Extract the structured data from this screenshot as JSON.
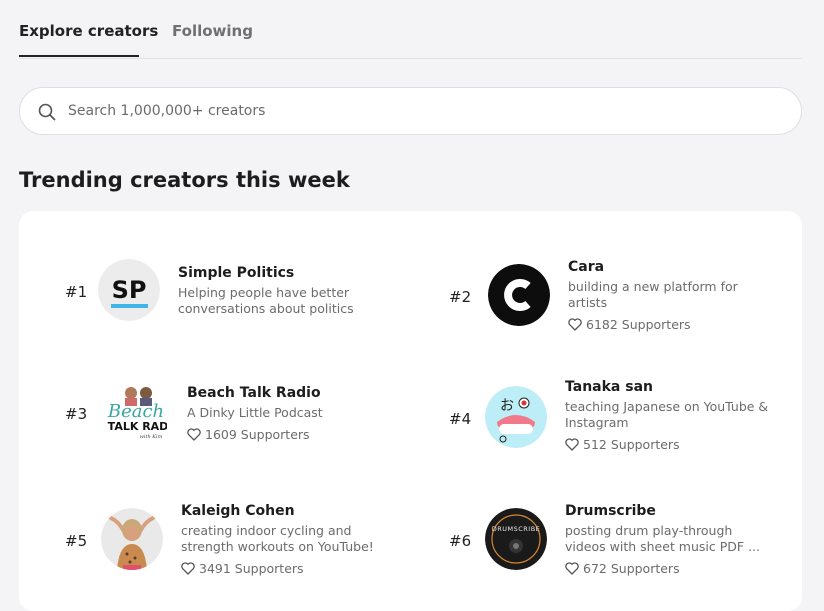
{
  "tabs": [
    {
      "label": "Explore creators"
    },
    {
      "label": "Following"
    }
  ],
  "search": {
    "placeholder": "Search 1,000,000+ creators",
    "value": ""
  },
  "trending": {
    "title": "Trending creators this week"
  },
  "creators": [
    {
      "rank": "#1",
      "name": "Simple Politics",
      "description": "Helping people have better conversations about politics",
      "supporters": "",
      "avatar": {
        "text": "SP",
        "colors": {
          "bg": "#ececec",
          "text": "#111111",
          "underline": "#3fb6e8"
        }
      }
    },
    {
      "rank": "#2",
      "name": "Cara",
      "description": "building a new platform for artists",
      "supporters": "6182 Supporters",
      "avatar": {
        "text": "C",
        "colors": {
          "bg": "#0d0d0d",
          "text": "#ffffff"
        }
      }
    },
    {
      "rank": "#3",
      "name": "Beach Talk Radio",
      "description": "A Dinky Little Podcast",
      "supporters": "1609 Supporters",
      "avatar": {
        "text": "Beach TALK RAD",
        "colors": {
          "bg": "#ffffff",
          "accent": "#3aa7a0"
        }
      }
    },
    {
      "rank": "#4",
      "name": "Tanaka san",
      "description": "teaching Japanese on YouTube & Instagram",
      "supporters": "512 Supporters",
      "avatar": {
        "text": "お",
        "colors": {
          "bg": "#bdeef7",
          "accent": "#f07a8a",
          "dot": "#e03030"
        }
      }
    },
    {
      "rank": "#5",
      "name": "Kaleigh Cohen",
      "description": "creating indoor cycling and strength workouts on YouTube!",
      "supporters": "3491 Supporters",
      "avatar": {
        "text": "",
        "colors": {
          "bg": "#e9e9e9",
          "skin": "#d9a07d",
          "hair": "#c9a878",
          "top": "#c98a50"
        }
      }
    },
    {
      "rank": "#6",
      "name": "Drumscribe",
      "description": "posting drum play-through videos with sheet music PDF ...",
      "supporters": "672 Supporters",
      "avatar": {
        "text": "DRUMSCRIBE",
        "colors": {
          "bg": "#1a1a1a",
          "ring": "#d88830",
          "text": "#e8e8e8"
        }
      }
    }
  ],
  "icons": {
    "search": "search-icon",
    "heart": "heart-icon"
  },
  "colors": {
    "background": "#f4f4f7",
    "card": "#ffffff",
    "text": "#222222",
    "muted": "#6b6b6b"
  }
}
